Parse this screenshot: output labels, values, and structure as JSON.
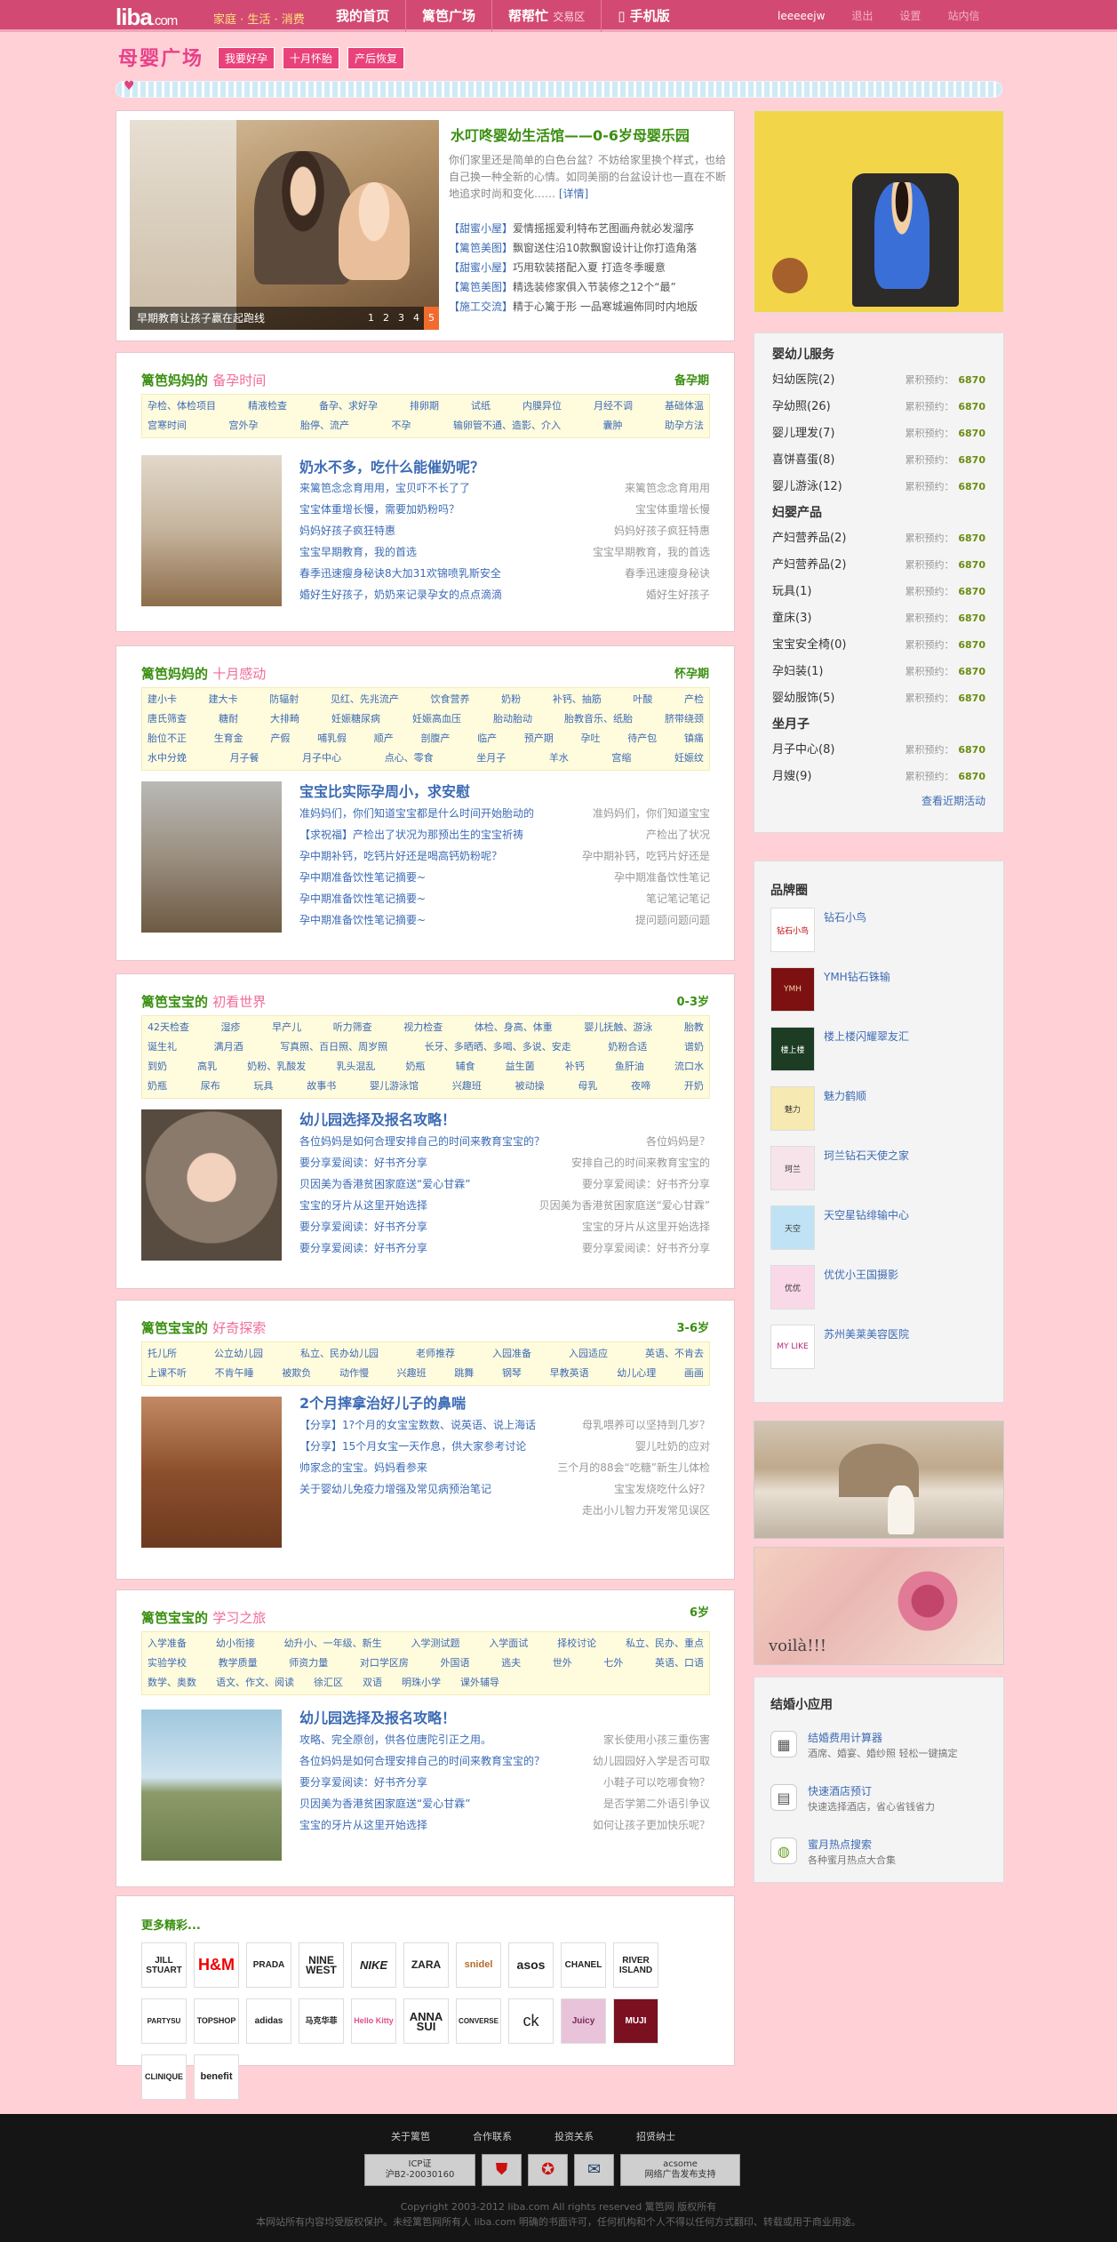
{
  "topbar": {
    "logo_main": "liba",
    "logo_suffix": ".com",
    "slogan": "家庭 · 生活 · 消费",
    "nav": [
      {
        "label": "我的首页",
        "sub": ""
      },
      {
        "label": "篱笆广场",
        "sub": ""
      },
      {
        "label": "帮帮忙",
        "sub": "交易区"
      },
      {
        "label": "手机版",
        "sub": ""
      }
    ],
    "username": "leeeeejw",
    "logout": "退出",
    "settings": "设置",
    "messages": "站内信"
  },
  "header": {
    "site_name": "母婴广场",
    "tags": [
      "我要好孕",
      "十月怀胎",
      "产后恢复"
    ]
  },
  "feature": {
    "image_caption": "早期教育让孩子赢在起跑线",
    "pager": [
      "1",
      "2",
      "3",
      "4",
      "5"
    ],
    "title": "水叮咚婴幼生活馆——0-6岁母婴乐园",
    "desc": "你们家里还是简单的白色台盆？不妨给家里换个样式，也给自己换一种全新的心情。如同美丽的台盆设计也一直在不断地追求时尚和变化……",
    "desc_link": "[详情]",
    "items": [
      {
        "tag": "【甜蜜小屋】",
        "text": "爱情摇摇爱利特布艺图画舟就必发溜序"
      },
      {
        "tag": "【篱笆美图】",
        "text": "飘窗送住沿10款飘窗设计让你打造角落"
      },
      {
        "tag": "【甜蜜小屋】",
        "text": "巧用软装搭配入夏 打造冬季暖意"
      },
      {
        "tag": "【篱笆美图】",
        "text": "精选装修家俱入节装修之12个“最”"
      },
      {
        "tag": "【施工交流】",
        "text": "精于心篱于形 一品寒城遍佈同时内地版"
      }
    ]
  },
  "sections": [
    {
      "brand": "篱笆妈妈的",
      "name": "备孕时间",
      "stage": "备孕期",
      "keywords": [
        [
          "孕检、体检项目",
          "精液检查",
          "备孕、求好孕",
          "排卵期",
          "试纸",
          "内膜异位",
          "月经不调",
          "基础体温"
        ],
        [
          "宫寒时间",
          "宫外孕",
          "胎停、流产",
          "不孕",
          "输卵管不通、造影、介入",
          "囊肿",
          "助孕方法"
        ]
      ],
      "title": "奶水不多，吃什么能催奶呢？",
      "items": [
        {
          "l": "来篱笆念念育用用，宝贝吓不长了了",
          "r": "来篱笆念念育用用"
        },
        {
          "l": "宝宝体重增长慢，需要加奶粉吗？",
          "r": "宝宝体重增长慢"
        },
        {
          "l": "妈妈好孩子疯狂特惠",
          "r": "妈妈好孩子疯狂特惠"
        },
        {
          "l": "宝宝早期教育，我的首选",
          "r": "宝宝早期教育，我的首选"
        },
        {
          "l": "春季迅速瘦身秘诀8大加31欢锦喷乳斯安全",
          "r": "春季迅速瘦身秘诀"
        },
        {
          "l": "婚好生好孩子，奶奶来记录孕女的点点滴滴",
          "r": "婚好生好孩子"
        }
      ]
    },
    {
      "brand": "篱笆妈妈的",
      "name": "十月感动",
      "stage": "怀孕期",
      "keywords": [
        [
          "建小卡",
          "建大卡",
          "防辐射",
          "见红、先兆流产",
          "饮食营养",
          "奶粉",
          "补钙、抽筋",
          "叶酸",
          "产检"
        ],
        [
          "唐氏筛查",
          "糖耐",
          "大排畸",
          "妊娠糖尿病",
          "妊娠高血压",
          "胎动胎动",
          "胎教音乐、纸胎",
          "脐带绕颈"
        ],
        [
          "胎位不正",
          "生育金",
          "产假",
          "哺乳假",
          "顺产",
          "剖腹产",
          "临产",
          "预产期",
          "孕吐",
          "待产包",
          "镇痛"
        ],
        [
          "水中分娩",
          "月子餐",
          "月子中心",
          "点心、零食",
          "坐月子",
          "羊水",
          "宫缩",
          "妊娠纹"
        ]
      ],
      "title": "宝宝比实际孕周小，求安慰",
      "items": [
        {
          "l": "准妈妈们，你们知道宝宝都是什么时间开始胎动的",
          "r": "准妈妈们，你们知道宝宝"
        },
        {
          "l": "【求祝福】产检出了状况为那预出生的宝宝祈祷",
          "r": "产检出了状况"
        },
        {
          "l": "孕中期补钙，吃钙片好还是喝高钙奶粉呢？",
          "r": "孕中期补钙，吃钙片好还是"
        },
        {
          "l": "孕中期准备饮性笔记摘要~",
          "r": "孕中期准备饮性笔记"
        },
        {
          "l": "孕中期准备饮性笔记摘要~",
          "r": "笔记笔记笔记"
        },
        {
          "l": "孕中期准备饮性笔记摘要~",
          "r": "提问题问题问题"
        }
      ]
    },
    {
      "brand": "篱笆宝宝的",
      "name": "初看世界",
      "stage": "0-3岁",
      "keywords": [
        [
          "42天检查",
          "湿疹",
          "早产儿",
          "听力筛查",
          "视力检查",
          "体检、身高、体重",
          "婴儿抚触、游泳",
          "胎教"
        ],
        [
          "诞生礼",
          "满月酒",
          "写真照、百日照、周岁照",
          "长牙、多晒晒、多喝、多说、安走",
          "奶粉合适",
          "谱奶"
        ],
        [
          "到奶",
          "高乳",
          "奶粉、乳酸发",
          "乳头混乱",
          "奶瓶",
          "辅食",
          "益生菌",
          "补钙",
          "鱼肝油",
          "流口水"
        ],
        [
          "奶瓶",
          "尿布",
          "玩具",
          "故事书",
          "婴儿游泳馆",
          "兴趣班",
          "被动操",
          "母乳",
          "夜啼",
          "开奶"
        ]
      ],
      "title": "幼儿园选择及报名攻略！",
      "items": [
        {
          "l": "各位妈妈是如何合理安排自己的时间来教育宝宝的？",
          "r": "各位妈妈是？"
        },
        {
          "l": "要分享爱阅读：好书齐分享",
          "r": "安排自己的时间来教育宝宝的"
        },
        {
          "l": "贝因美为香港贫困家庭送“爱心甘霖”",
          "r": "要分享爱阅读：好书齐分享"
        },
        {
          "l": "宝宝的牙片从这里开始选择",
          "r": "贝因美为香港贫困家庭送“爱心甘霖”"
        },
        {
          "l": "要分享爱阅读：好书齐分享",
          "r": "宝宝的牙片从这里开始选择"
        },
        {
          "l": "要分享爱阅读：好书齐分享",
          "r": "要分享爱阅读：好书齐分享"
        }
      ]
    },
    {
      "brand": "篱笆宝宝的",
      "name": "好奇探索",
      "stage": "3-6岁",
      "keywords": [
        [
          "托儿所",
          "公立幼儿园",
          "私立、民办幼儿园",
          "老师推荐",
          "入园准备",
          "入园适应",
          "英语、不肯去"
        ],
        [
          "上课不听",
          "不肯午睡",
          "被欺负",
          "动作慢",
          "兴趣班",
          "跳舞",
          "钢琴",
          "早教英语",
          "幼儿心理",
          "画画"
        ]
      ],
      "title": "2个月摔拿治好儿子的鼻喘",
      "items": [
        {
          "l": "【分享】1?个月的女宝宝数数、说英语、说上海话",
          "r": "母乳喂养可以坚持到几岁？"
        },
        {
          "l": "【分享】15个月女宝一天作息，供大家参考讨论",
          "r": "婴儿吐奶的应对"
        },
        {
          "l": "帅家念的宝宝。妈妈看参来",
          "r": "三个月的88会“吃糖”新生儿体检"
        },
        {
          "l": "关于婴幼儿免疫力增强及常见病预治笔记",
          "r": "宝宝发烧吃什么好？"
        },
        {
          "l": "",
          "r": "走出小儿智力开发常见误区"
        }
      ]
    },
    {
      "brand": "篱笆宝宝的",
      "name": "学习之旅",
      "stage": "6岁",
      "keywords": [
        [
          "入学准备",
          "幼小衔接",
          "幼升小、一年级、新生",
          "入学测试题",
          "入学面试",
          "择校讨论",
          "私立、民办、重点"
        ],
        [
          "实验学校",
          "教学质量",
          "师资力量",
          "对口学区房",
          "外国语",
          "逃夫",
          "世外",
          "七外",
          "英语、口语"
        ],
        [
          "数学、奥数",
          "语文、作文、阅读",
          "徐汇区",
          "双语",
          "明珠小学",
          "课外辅导"
        ]
      ],
      "title": "幼儿园选择及报名攻略！",
      "items": [
        {
          "l": "攻略、完全原创，供各位唐陀引正之用。",
          "r": "家长使用小孩三重伤害"
        },
        {
          "l": "各位妈妈是如何合理安排自己的时间来教育宝宝的？",
          "r": "幼儿园园好入学是否可取"
        },
        {
          "l": "要分享爱阅读：好书齐分享",
          "r": "小鞋子可以吃哪食物？"
        },
        {
          "l": "贝因美为香港贫困家庭送“爱心甘霖”",
          "r": "是否学第二外语引争议"
        },
        {
          "l": "宝宝的牙片从这里开始选择",
          "r": "如何让孩子更加快乐呢？"
        }
      ]
    }
  ],
  "sidebar_services": {
    "groups": [
      {
        "title": "婴幼儿服务",
        "items": [
          {
            "name": "妇幼医院(2)",
            "rl": "累积预约：",
            "rv": "6870"
          },
          {
            "name": "孕幼照(26)",
            "rl": "累积预约：",
            "rv": "6870"
          },
          {
            "name": "婴儿理发(7)",
            "rl": "累积预约：",
            "rv": "6870"
          },
          {
            "name": "喜饼喜蛋(8)",
            "rl": "累积预约：",
            "rv": "6870"
          },
          {
            "name": "婴儿游泳(12)",
            "rl": "累积预约：",
            "rv": "6870"
          }
        ]
      },
      {
        "title": "妇婴产品",
        "items": [
          {
            "name": "产妇营养品(2)",
            "rl": "累积预约：",
            "rv": "6870"
          },
          {
            "name": "产妇营养品(2)",
            "rl": "累积预约：",
            "rv": "6870"
          },
          {
            "name": "玩具(1)",
            "rl": "累积预约：",
            "rv": "6870"
          },
          {
            "name": "童床(3)",
            "rl": "累积预约：",
            "rv": "6870"
          },
          {
            "name": "宝宝安全椅(0)",
            "rl": "累积预约：",
            "rv": "6870"
          },
          {
            "name": "孕妇装(1)",
            "rl": "累积预约：",
            "rv": "6870"
          },
          {
            "name": "婴幼服饰(5)",
            "rl": "累积预约：",
            "rv": "6870"
          }
        ]
      },
      {
        "title": "坐月子",
        "items": [
          {
            "name": "月子中心(8)",
            "rl": "累积预约：",
            "rv": "6870"
          },
          {
            "name": "月嫂(9)",
            "rl": "累积预约：",
            "rv": "6870"
          }
        ]
      }
    ],
    "more": "查看近期活动"
  },
  "brand_box": {
    "title": "品牌圈",
    "brands": [
      {
        "logo": "钻石小鸟",
        "name": "钻石小鸟"
      },
      {
        "logo": "YMH",
        "name": "YMH钻石铢输"
      },
      {
        "logo": "楼上楼",
        "name": "楼上楼闪耀翠友汇"
      },
      {
        "logo": "魅力",
        "name": "魅力鹤顺"
      },
      {
        "logo": "珂兰",
        "name": "珂兰钻石天使之家"
      },
      {
        "logo": "天空",
        "name": "天空星钻绯输中心"
      },
      {
        "logo": "优优",
        "name": "优优小王国摄影"
      },
      {
        "logo": "MY LIKE",
        "name": "苏州美莱美容医院"
      }
    ]
  },
  "photo_b_text": "voilà!!!",
  "apps": {
    "title": "结婚小应用",
    "items": [
      {
        "icon": "▦",
        "t1": "结婚费用计算器",
        "t2": "酒席、婚宴、婚纱照 轻松一键搞定"
      },
      {
        "icon": "▤",
        "t1": "快速酒店预订",
        "t2": "快速选择酒店，省心省钱省力"
      },
      {
        "icon": "◍",
        "t1": "蜜月热点搜索",
        "t2": "各种蜜月热点大合集"
      }
    ]
  },
  "logos": {
    "title": "更多精彩...",
    "items": [
      "JILL STUART",
      "H&M",
      "PRADA",
      "NINE WEST",
      "NIKE",
      "ZARA",
      "snidel",
      "asos",
      "CHANEL",
      "RIVER ISLAND",
      "PARTYSU",
      "TOPSHOP",
      "adidas",
      "马克华菲",
      "Hello Kitty",
      "ANNA SUI",
      "CONVERSE",
      "ck",
      "Juicy",
      "MUJI",
      "CLINIQUE",
      "benefit"
    ]
  },
  "footer": {
    "links": [
      "关于篱笆",
      "合作联系",
      "投资关系",
      "招贤纳士"
    ],
    "badges": [
      "ICP证\n沪B2-20030160",
      "",
      "",
      "",
      "acsome\n网络广告发布支持"
    ],
    "copy1": "Copyright 2003-2012 liba.com All rights reserved 篱笆网 版权所有",
    "copy2": "本网站所有内容均受版权保护。未经篱笆网所有人 liba.com 明确的书面许可，任何机构和个人不得以任何方式翻印、转载或用于商业用途。"
  },
  "colors": {
    "accent": "#d24a74",
    "pink_bg": "#ffd1d6",
    "green": "#3a8f10",
    "link": "#3c6bb5"
  }
}
